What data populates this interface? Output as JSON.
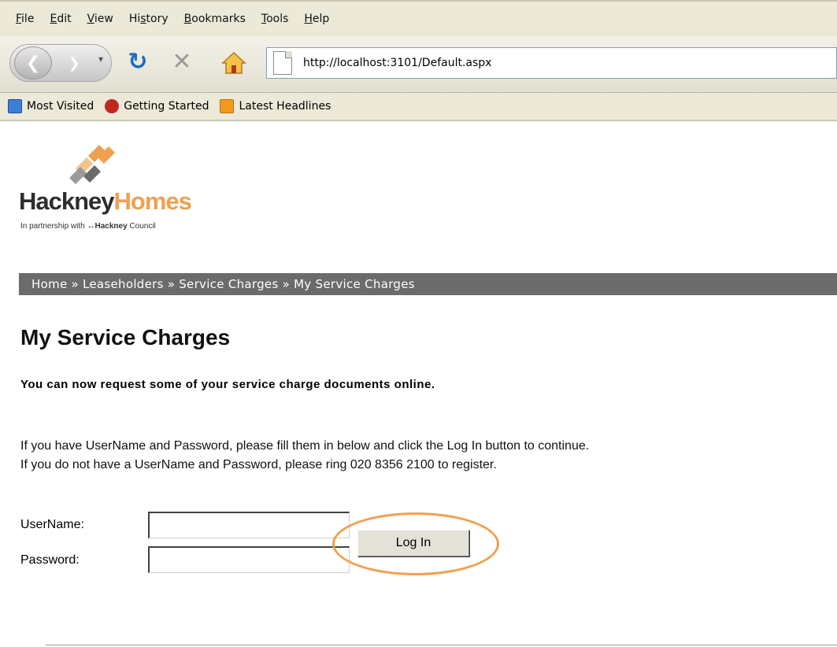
{
  "browser": {
    "menu": [
      {
        "label": "File"
      },
      {
        "label": "Edit"
      },
      {
        "label": "View"
      },
      {
        "label": "History"
      },
      {
        "label": "Bookmarks"
      },
      {
        "label": "Tools"
      },
      {
        "label": "Help"
      }
    ],
    "url": "http://localhost:3101/Default.aspx",
    "bookmarks": [
      {
        "label": "Most Visited",
        "icon": "most-visited-icon"
      },
      {
        "label": "Getting Started",
        "icon": "firefox-icon"
      },
      {
        "label": "Latest Headlines",
        "icon": "rss-icon"
      }
    ]
  },
  "logo": {
    "word_dark": "Hackney",
    "word_light": "Homes",
    "tagline_prefix": "In partnership with ",
    "tagline_brand": "Hackney",
    "tagline_suffix": " Council",
    "colors": {
      "orange": "#f0a050",
      "dark": "#2d2d2d"
    }
  },
  "breadcrumb": {
    "items": [
      "Home",
      "Leaseholders",
      "Service Charges",
      "My Service Charges"
    ],
    "separator": "»"
  },
  "page": {
    "title": "My Service Charges",
    "subtitle": "You can now request some of your service charge documents online.",
    "instruction_1": "If you have UserName and Password, please fill them in below and click the Log In button to continue.",
    "instruction_2": "If you do not have a UserName and Password, please ring 020 8356 2100 to register."
  },
  "login": {
    "username_label": "UserName:",
    "password_label": "Password:",
    "username_value": "",
    "password_value": "",
    "button_label": "Log In"
  }
}
